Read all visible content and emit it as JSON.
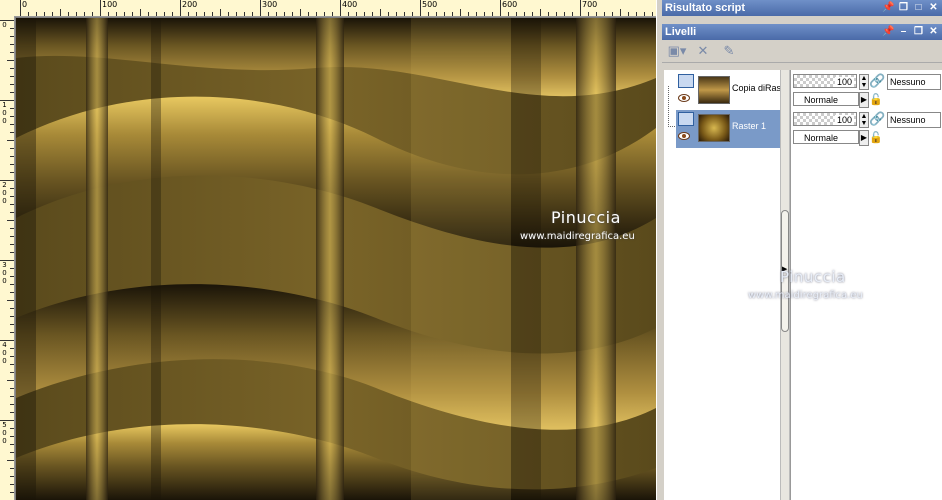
{
  "rulers": {
    "top_labels": [
      "0",
      "100",
      "200",
      "300",
      "400",
      "500",
      "600",
      "700"
    ],
    "left_labels": [
      [
        "0"
      ],
      [
        "1",
        "0",
        "0"
      ],
      [
        "2",
        "0",
        "0"
      ],
      [
        "3",
        "0",
        "0"
      ],
      [
        "4",
        "0",
        "0"
      ],
      [
        "5",
        "0",
        "0"
      ]
    ]
  },
  "canvas": {
    "watermark_name": "Pinuccia",
    "watermark_url": "www.maidiregrafica.eu"
  },
  "panels": {
    "script": {
      "title": "Risultato script"
    },
    "layers": {
      "title": "Livelli",
      "items": [
        {
          "name": "Copia diRas",
          "opacity": "100",
          "blend": "Normale",
          "mask": "Nessuno",
          "selected": false
        },
        {
          "name": "Raster 1",
          "opacity": "100",
          "blend": "Normale",
          "mask": "Nessuno",
          "selected": true
        }
      ],
      "watermark_name": "Pinuccia",
      "watermark_url": "www.maidiregrafica.eu"
    }
  },
  "colors": {
    "titlebar": "#5a7ab8",
    "selected_row": "#7a9ac8",
    "gold_light": "#e8c860",
    "gold_dark": "#1a1408"
  },
  "icons": {
    "pin": "pin-icon",
    "restore": "restore-icon",
    "maximize": "maximize-icon",
    "close": "close-icon",
    "eye": "eye-icon",
    "link": "link-icon",
    "lock": "lock-icon"
  }
}
